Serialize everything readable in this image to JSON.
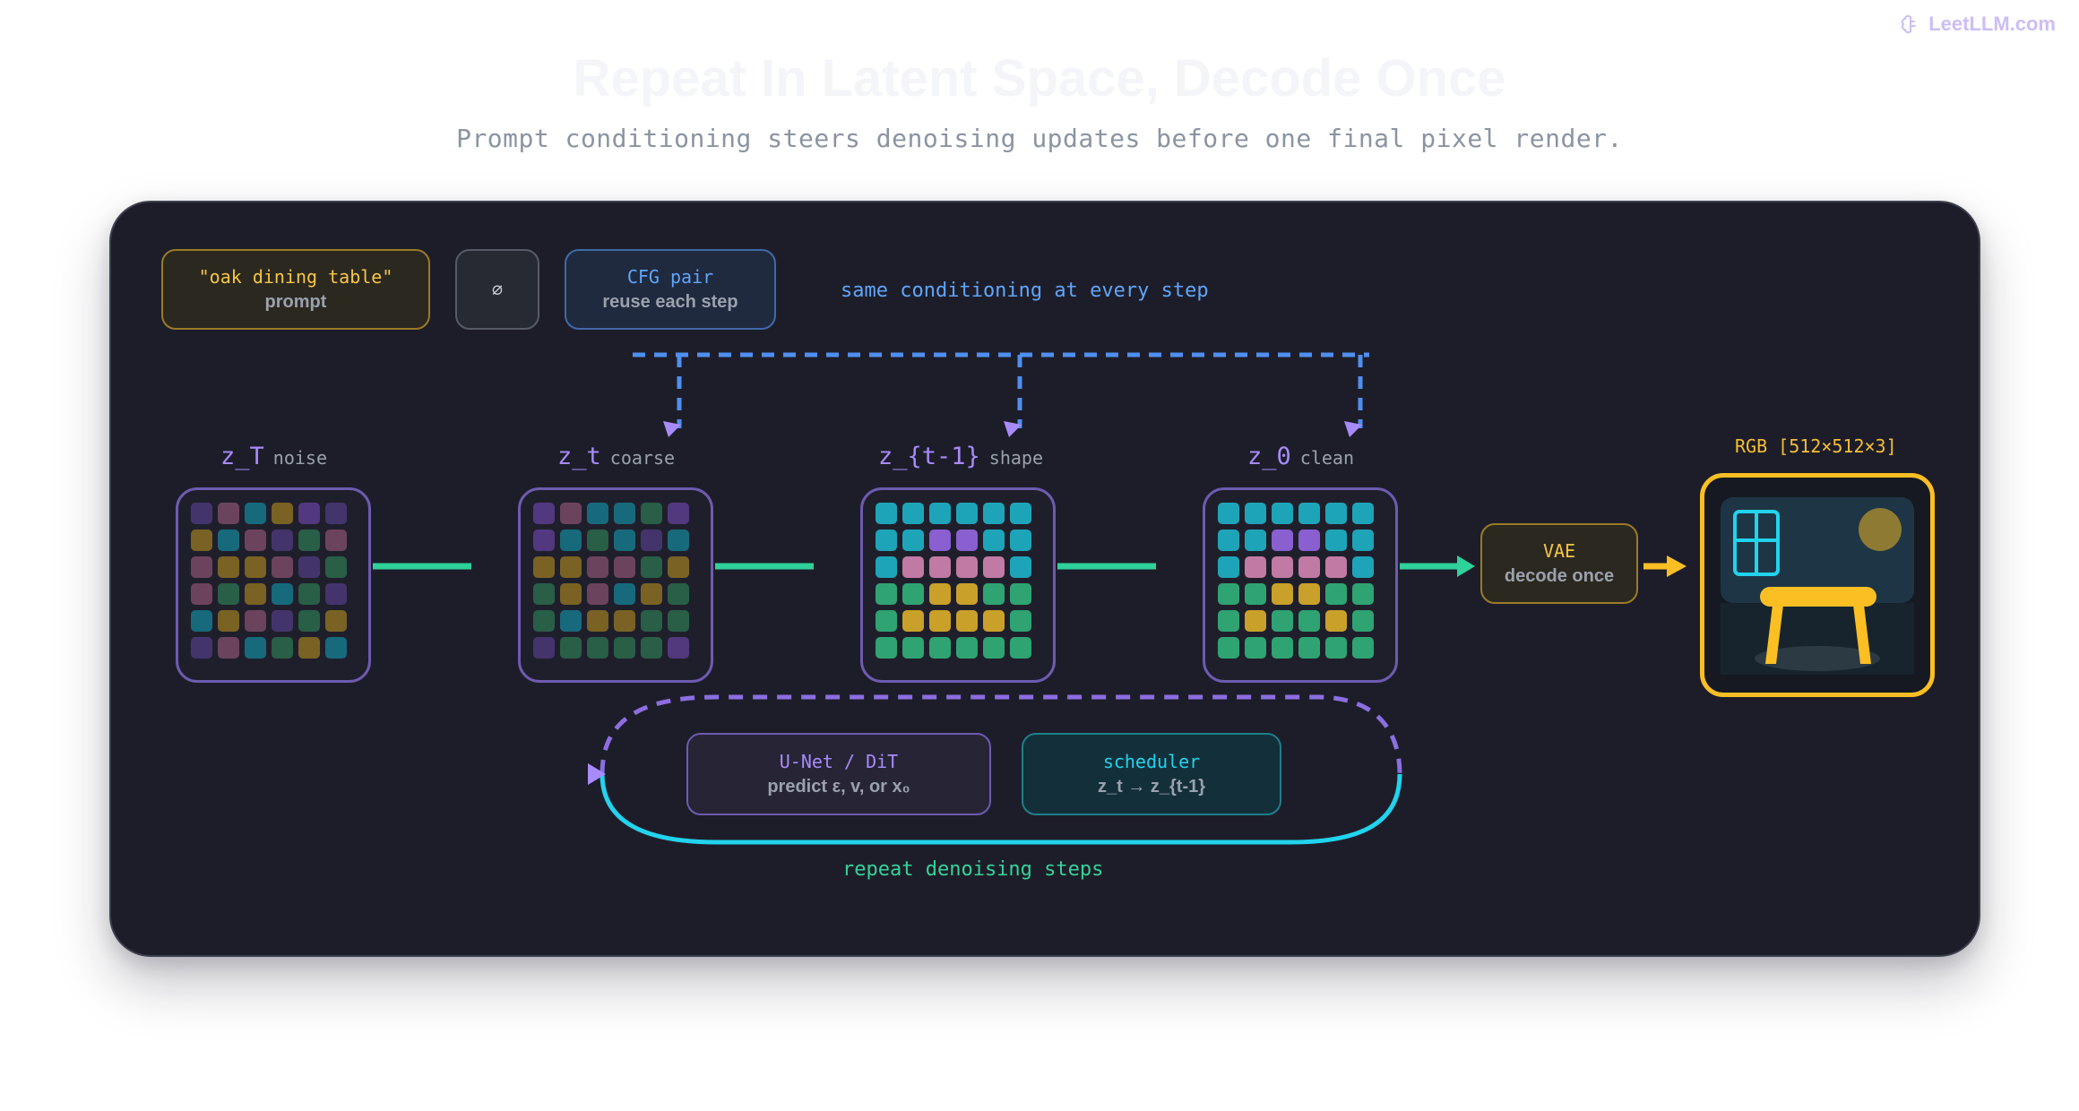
{
  "brand": {
    "name": "LeetLLM.com",
    "icon": "brain-icon"
  },
  "title": "Repeat In Latent Space, Decode Once",
  "subtitle": "Prompt conditioning steers denoising updates before one final pixel render.",
  "conditioning": {
    "prompt": {
      "text": "\"oak dining table\"",
      "caption": "prompt"
    },
    "null_token": "∅",
    "cfg": {
      "title": "CFG pair",
      "caption": "reuse each step"
    },
    "note": "same conditioning at every step"
  },
  "latents": [
    {
      "name": "z_T",
      "tag": "noise"
    },
    {
      "name": "z_t",
      "tag": "coarse"
    },
    {
      "name": "z_{t-1}",
      "tag": "shape"
    },
    {
      "name": "z_0",
      "tag": "clean"
    }
  ],
  "vae": {
    "title": "VAE",
    "caption": "decode once"
  },
  "output": {
    "label": "RGB [512×512×3]"
  },
  "loop": {
    "model": {
      "title": "U-Net / DiT",
      "caption": "predict ε, v, or x₀"
    },
    "scheduler": {
      "title": "scheduler",
      "caption": "z_t → z_{t-1}"
    },
    "note": "repeat denoising steps"
  },
  "colors": {
    "accent_purple": "#a78bfa",
    "accent_blue": "#60a5fa",
    "accent_green": "#34d399",
    "accent_cyan": "#22d3ee",
    "accent_amber": "#fbbf24",
    "panel_bg": "#1d1d29"
  }
}
